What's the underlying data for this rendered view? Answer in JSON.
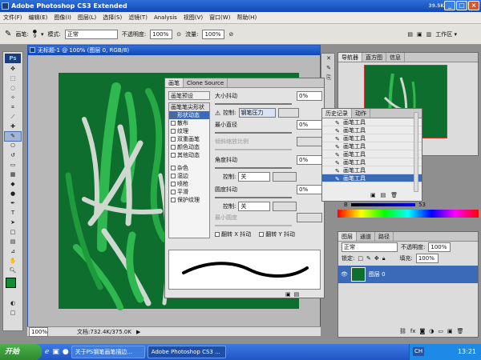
{
  "app": {
    "title": "Adobe Photoshop CS3 Extended",
    "corner_badge": "39.5K"
  },
  "menu": [
    "文件(F)",
    "编辑(E)",
    "图像(I)",
    "图层(L)",
    "选择(S)",
    "滤镜(T)",
    "Analysis",
    "视图(V)",
    "窗口(W)",
    "帮助(H)"
  ],
  "options_bar": {
    "brush_label": "画笔:",
    "brush_size": "9",
    "mode_label": "模式:",
    "mode_value": "正常",
    "opacity_label": "不透明度:",
    "opacity_value": "100%",
    "flow_label": "流量:",
    "flow_value": "100%",
    "workspace_label": "工作区"
  },
  "document": {
    "title": "无标题-1 @ 100% (图层 0, RGB/8)",
    "zoom": "100%",
    "doc_size": "文档:732.4K/375.0K",
    "canvas_color": "#0e6e2e"
  },
  "brush_panel": {
    "tabs": [
      "画笔",
      "Clone Source"
    ],
    "presets_label": "画笔预设",
    "options": [
      {
        "label": "画笔笔尖形状",
        "checked": false,
        "header": true
      },
      {
        "label": "形状动态",
        "checked": true,
        "selected": true
      },
      {
        "label": "散布",
        "checked": false
      },
      {
        "label": "纹理",
        "checked": false
      },
      {
        "label": "双重画笔",
        "checked": false
      },
      {
        "label": "颜色动态",
        "checked": false
      },
      {
        "label": "其他动态",
        "checked": false
      },
      {
        "label": "杂色",
        "checked": false
      },
      {
        "label": "湿边",
        "checked": false
      },
      {
        "label": "喷枪",
        "checked": false
      },
      {
        "label": "平滑",
        "checked": false
      },
      {
        "label": "保护纹理",
        "checked": false
      }
    ],
    "size_jitter_label": "大小抖动",
    "size_jitter_value": "0%",
    "control_label": "控制:",
    "control_value": "钢笔压力",
    "min_diameter_label": "最小直径",
    "min_diameter_value": "0%",
    "tilt_scale_label": "倾斜缩放比例",
    "angle_jitter_label": "角度抖动",
    "angle_jitter_value": "0%",
    "angle_control_value": "关",
    "roundness_jitter_label": "圆度抖动",
    "roundness_jitter_value": "0%",
    "roundness_control_value": "关",
    "min_roundness_label": "最小圆度",
    "flip_x_label": "翻转 X 抖动",
    "flip_y_label": "翻转 Y 抖动"
  },
  "history_panel": {
    "tabs": [
      "历史记录",
      "动作"
    ],
    "items": [
      "画笔工具",
      "画笔工具",
      "画笔工具",
      "画笔工具",
      "画笔工具",
      "画笔工具",
      "画笔工具",
      "画笔工具"
    ],
    "selected_index": 7
  },
  "navigator_panel": {
    "tabs": [
      "导航器",
      "直方图",
      "信息"
    ],
    "channel_label": "B",
    "channel_value": "53"
  },
  "layers_panel": {
    "tabs": [
      "图层",
      "通道",
      "路径"
    ],
    "blend_mode": "正常",
    "opacity_label": "不透明度:",
    "opacity_value": "100%",
    "lock_label": "锁定:",
    "fill_label": "填充:",
    "fill_value": "100%",
    "layer_name": "图层 0"
  },
  "taskbar": {
    "start_label": "开始",
    "items": [
      "关于PS钢笔画笔描边...",
      "Adobe Photoshop CS3 ..."
    ],
    "ime": "CH",
    "clock": "13:21"
  },
  "colors": {
    "canvas_green": "#0e6e2e",
    "stroke_bright": "#2fb84f",
    "stroke_light": "#cfd8cf",
    "accent": "#3a6ab8"
  }
}
